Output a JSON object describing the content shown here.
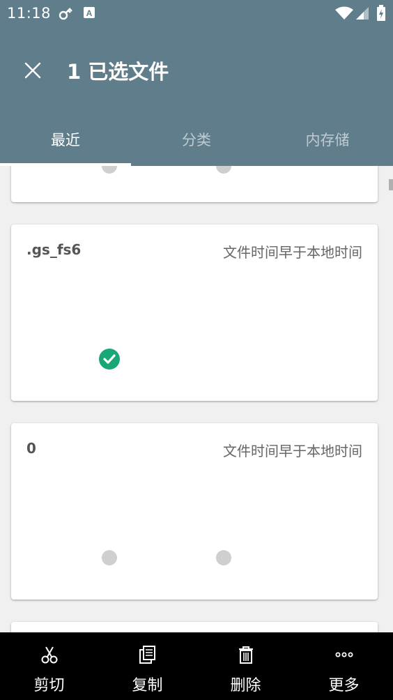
{
  "status": {
    "time": "11:18"
  },
  "header": {
    "title": "1 已选文件"
  },
  "tabs": [
    {
      "label": "最近",
      "active": true
    },
    {
      "label": "分类",
      "active": false
    },
    {
      "label": "内存储",
      "active": false
    }
  ],
  "cards": [
    {
      "name": "",
      "note": ""
    },
    {
      "name": ".gs_fs6",
      "note": "文件时间早于本地时间",
      "selected": true
    },
    {
      "name": "0",
      "note": "文件时间早于本地时间",
      "selected": false
    }
  ],
  "actions": [
    {
      "label": "剪切",
      "icon": "scissors-icon"
    },
    {
      "label": "复制",
      "icon": "copy-icon"
    },
    {
      "label": "删除",
      "icon": "trash-icon"
    },
    {
      "label": "更多",
      "icon": "more-icon"
    }
  ],
  "colors": {
    "appbar": "#607d8b",
    "check": "#1aa776",
    "bottombar": "#000000"
  }
}
